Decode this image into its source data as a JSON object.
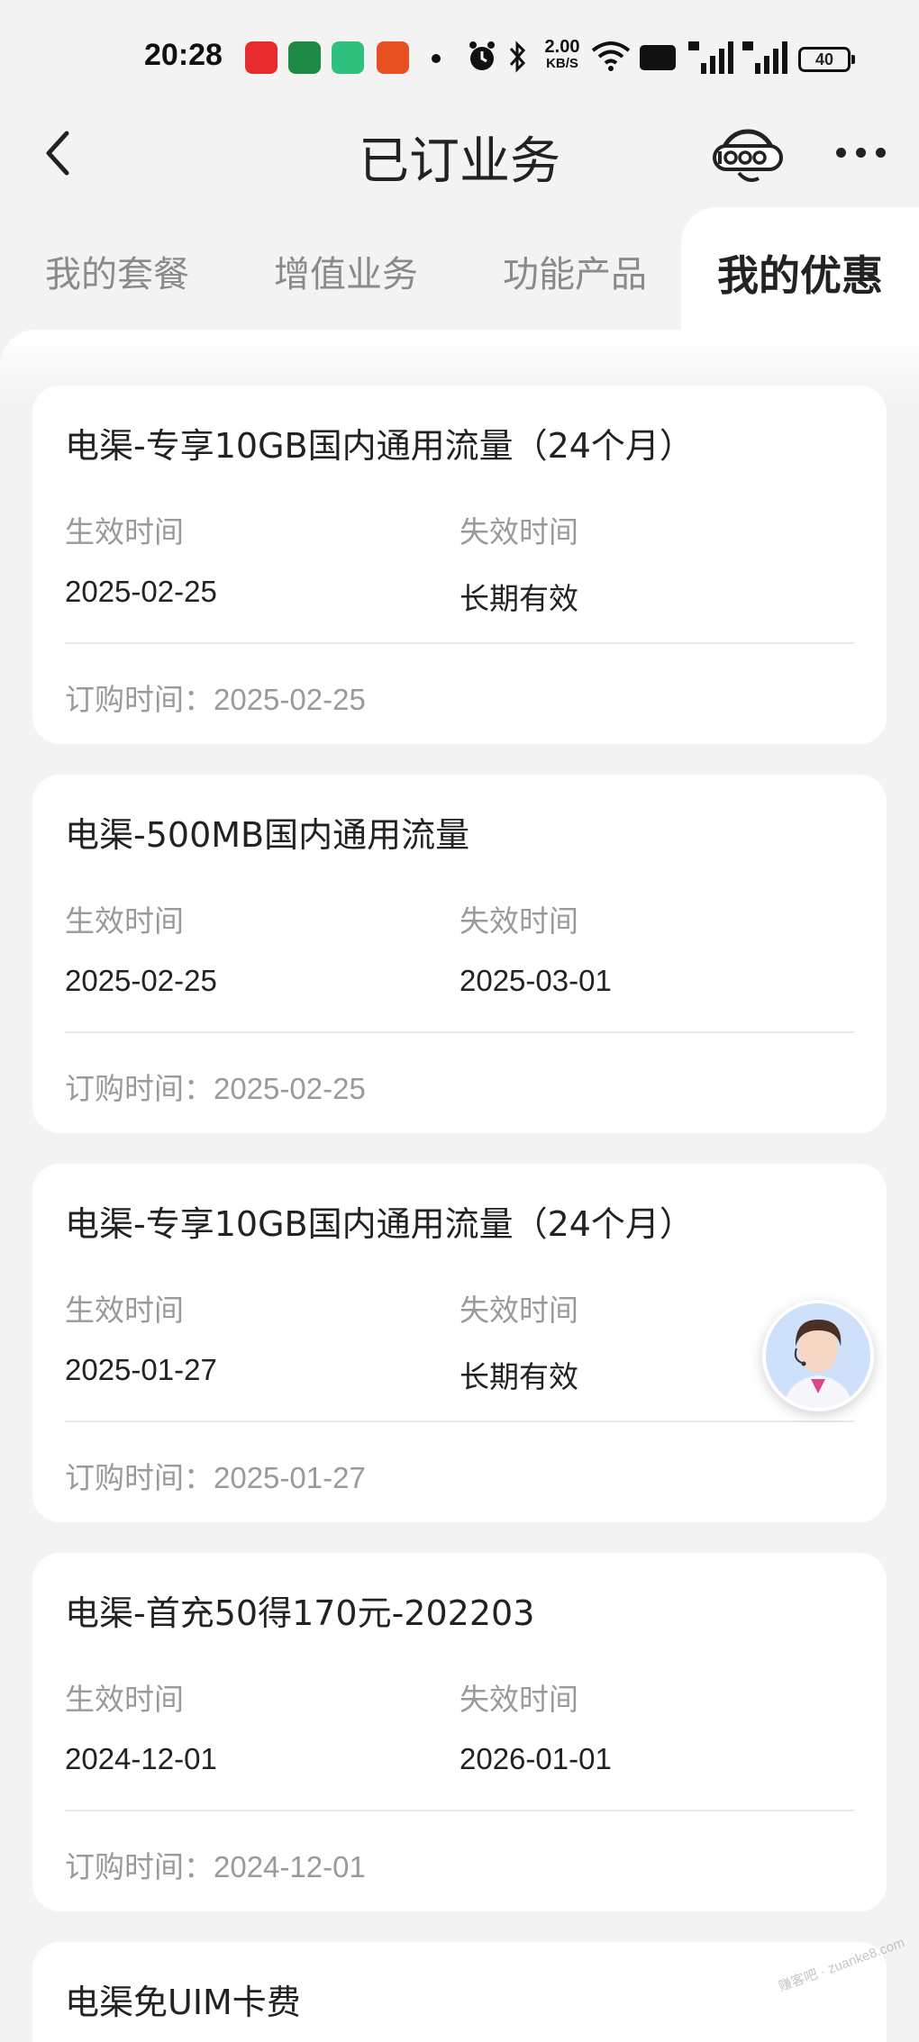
{
  "status_bar": {
    "time": "20:28",
    "net_speed_value": "2.00",
    "net_speed_unit": "KB/S",
    "battery": "40",
    "icons": [
      "app-store-icon",
      "oppo-app-icon",
      "iqiyi-app-icon",
      "ting-app-icon",
      "dot-icon",
      "alarm-icon",
      "bluetooth-icon",
      "wifi-icon",
      "hd-icon",
      "5g-signal-icon",
      "5g-signal-icon",
      "battery-icon"
    ]
  },
  "header": {
    "title": "已订业务",
    "hotline_icon": "10000-hotline-icon",
    "more_icon": "more-icon",
    "back_icon": "chevron-left-icon"
  },
  "tabs": [
    {
      "label": "我的套餐",
      "active": false
    },
    {
      "label": "增值业务",
      "active": false
    },
    {
      "label": "功能产品",
      "active": false
    },
    {
      "label": "我的优惠",
      "active": true
    }
  ],
  "labels": {
    "start": "生效时间",
    "end": "失效时间",
    "order_prefix": "订购时间："
  },
  "cards": [
    {
      "title": "电渠-专享10GB国内通用流量（24个月）",
      "start": "2025-02-25",
      "end": "长期有效",
      "order": "2025-02-25"
    },
    {
      "title": "电渠-500MB国内通用流量",
      "start": "2025-02-25",
      "end": "2025-03-01",
      "order": "2025-02-25"
    },
    {
      "title": "电渠-专享10GB国内通用流量（24个月）",
      "start": "2025-01-27",
      "end": "长期有效",
      "order": "2025-01-27"
    },
    {
      "title": "电渠-首充50得170元-202203",
      "start": "2024-12-01",
      "end": "2026-01-01",
      "order": "2024-12-01"
    },
    {
      "title": "电渠免UIM卡费"
    }
  ],
  "colors": {
    "background": "#f2f2f2",
    "card": "#ffffff",
    "label_gray": "#9a9a9a",
    "text_dark": "#222222"
  }
}
